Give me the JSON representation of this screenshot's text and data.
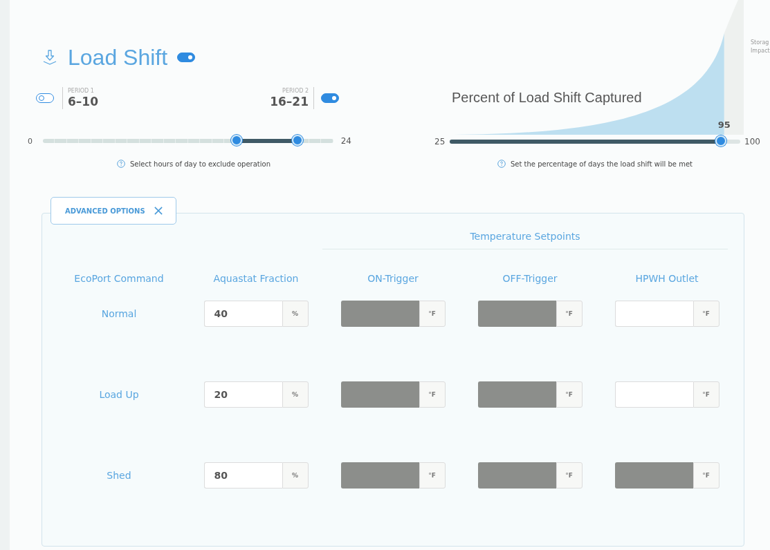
{
  "header": {
    "title": "Load Shift",
    "enabled": true
  },
  "periods": [
    {
      "label": "PERIOD 1",
      "range": "6–10",
      "enabled": false
    },
    {
      "label": "PERIOD 2",
      "range": "16–21",
      "enabled": true
    }
  ],
  "hour_slider": {
    "min": "0",
    "max": "24",
    "thumbs": [
      {
        "level": 0.667
      },
      {
        "level": 0.875
      }
    ],
    "help": "Select hours of day to exclude operation"
  },
  "capture": {
    "title": "Percent of Load Shift Captured",
    "min": "25",
    "max": "100",
    "value": "95",
    "level": 0.933,
    "help": "Set the percentage of days the load shift will be met",
    "side_label": [
      "Storag",
      "Impact"
    ]
  },
  "advanced": {
    "tab_label": "ADVANCED OPTIONS",
    "group_heading": "Temperature Setpoints",
    "columns": [
      "EcoPort Command",
      "Aquastat Fraction",
      "ON-Trigger",
      "OFF-Trigger",
      "HPWH Outlet"
    ],
    "rows": [
      {
        "command": "Normal",
        "aquastat": {
          "value": "40",
          "unit": "%"
        },
        "setpoints": [
          {
            "unit": "°F",
            "disabled": true
          },
          {
            "unit": "°F",
            "disabled": true
          },
          {
            "unit": "°F",
            "disabled": false
          }
        ]
      },
      {
        "command": "Load Up",
        "aquastat": {
          "value": "20",
          "unit": "%"
        },
        "setpoints": [
          {
            "unit": "°F",
            "disabled": true
          },
          {
            "unit": "°F",
            "disabled": true
          },
          {
            "unit": "°F",
            "disabled": false
          }
        ]
      },
      {
        "command": "Shed",
        "aquastat": {
          "value": "80",
          "unit": "%"
        },
        "setpoints": [
          {
            "unit": "°F",
            "disabled": true
          },
          {
            "unit": "°F",
            "disabled": true
          },
          {
            "unit": "°F",
            "disabled": true
          }
        ]
      }
    ]
  }
}
